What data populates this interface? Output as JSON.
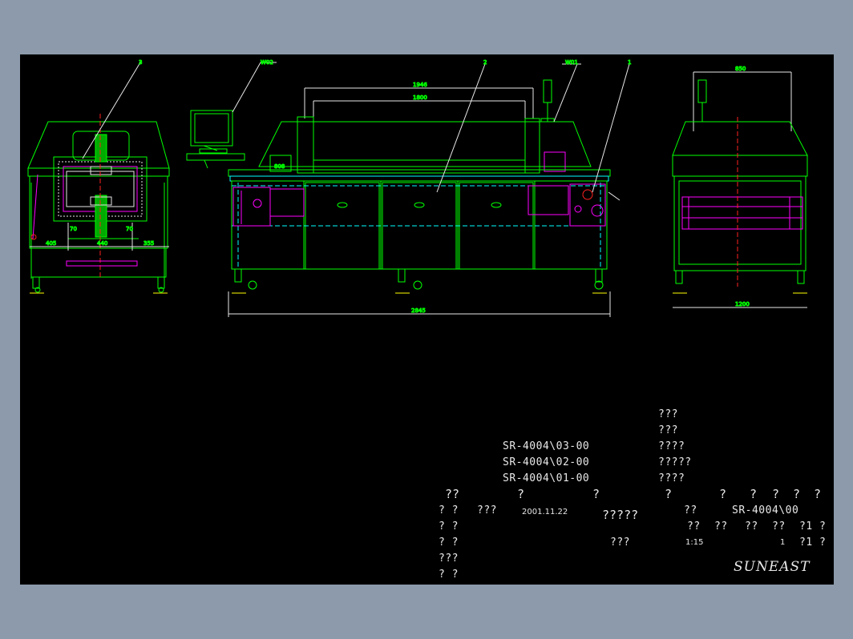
{
  "colors": {
    "background": "#8c9aab",
    "paper": "#000000",
    "line": "#00ff00",
    "accent": "#ff00ff",
    "cyan": "#00ffff",
    "text": "#e8e8e8",
    "red": "#ff2020",
    "yellow": "#ffff00"
  },
  "callouts": {
    "c3": "3",
    "w02": "W02",
    "c2": "2",
    "w01": "W01",
    "c1": "1"
  },
  "dims": {
    "overall_length": "2845",
    "tunnel_outer": "1946",
    "tunnel_inner": "1800",
    "side_top": "850",
    "side_bottom": "1200",
    "end_left": "405",
    "end_mid": "440",
    "end_right": "355",
    "end_gap_a": "70",
    "end_gap_b": "70",
    "panel_label": "808"
  },
  "parts_list": [
    {
      "code": "SR-4004\\03-00",
      "name": "???"
    },
    {
      "code": "SR-4004\\02-00",
      "name": "???"
    },
    {
      "code": "SR-4004\\01-00",
      "name": "????"
    }
  ],
  "parts_extra": [
    "?????",
    "????"
  ],
  "title_block": {
    "header": [
      "??",
      "?",
      "?",
      "?",
      "?",
      "?",
      "?",
      "?",
      "?"
    ],
    "row1": {
      "a": "? ?",
      "b": "???",
      "date": "2001.11.22",
      "drawing_name": "?????",
      "c": "??",
      "drawing_no": "SR-4004\\00"
    },
    "row2": {
      "a": "? ?",
      "c1": "??",
      "c2": "??",
      "c3": "??",
      "c4": "??",
      "c5": "?1 ?"
    },
    "row3": {
      "a": "? ?",
      "material": "???",
      "scale": "1:15",
      "qty": "1",
      "sheet": "?1 ?"
    },
    "row4": {
      "a": "???"
    },
    "row5": {
      "a": "? ?"
    },
    "company": "SUNEAST"
  }
}
